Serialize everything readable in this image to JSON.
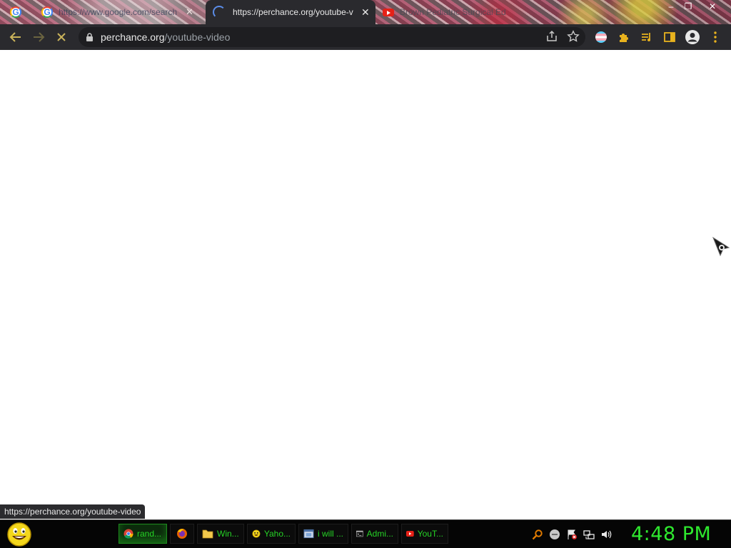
{
  "window": {
    "tabs": [
      {
        "title": "https://www.google.com/search",
        "icon": "google-icon"
      },
      {
        "title": "https://perchance.org/youtube-v",
        "icon": "loading-spinner-icon",
        "active": true
      },
      {
        "title": "Brown Pediatric Surgical Ed",
        "icon": "youtube-icon"
      }
    ],
    "controls": {
      "minimize": "–",
      "maximize": "❐",
      "close": "✕"
    }
  },
  "toolbar": {
    "url_host": "perchance.org",
    "url_path": "/youtube-video"
  },
  "status_bar": {
    "text": "https://perchance.org/youtube-video"
  },
  "taskbar": {
    "items": [
      {
        "label": "rand...",
        "icon": "chrome-icon",
        "active": true
      },
      {
        "label": "",
        "icon": "firefox-icon"
      },
      {
        "label": "Win...",
        "icon": "folder-icon"
      },
      {
        "label": "Yaho...",
        "icon": "yahoo-messenger-icon"
      },
      {
        "label": "i will ...",
        "icon": "window-icon"
      },
      {
        "label": "Admi...",
        "icon": "cmd-icon"
      },
      {
        "label": "YouT...",
        "icon": "youtube-icon"
      }
    ],
    "clock": "4:48 PM"
  },
  "colors": {
    "toolbar_bg": "#2a2a2e",
    "omnibox_bg": "#1e1e21",
    "taskbar_text": "#26d426",
    "clock": "#2ee82e",
    "extension_accent": "#e8b21e"
  }
}
